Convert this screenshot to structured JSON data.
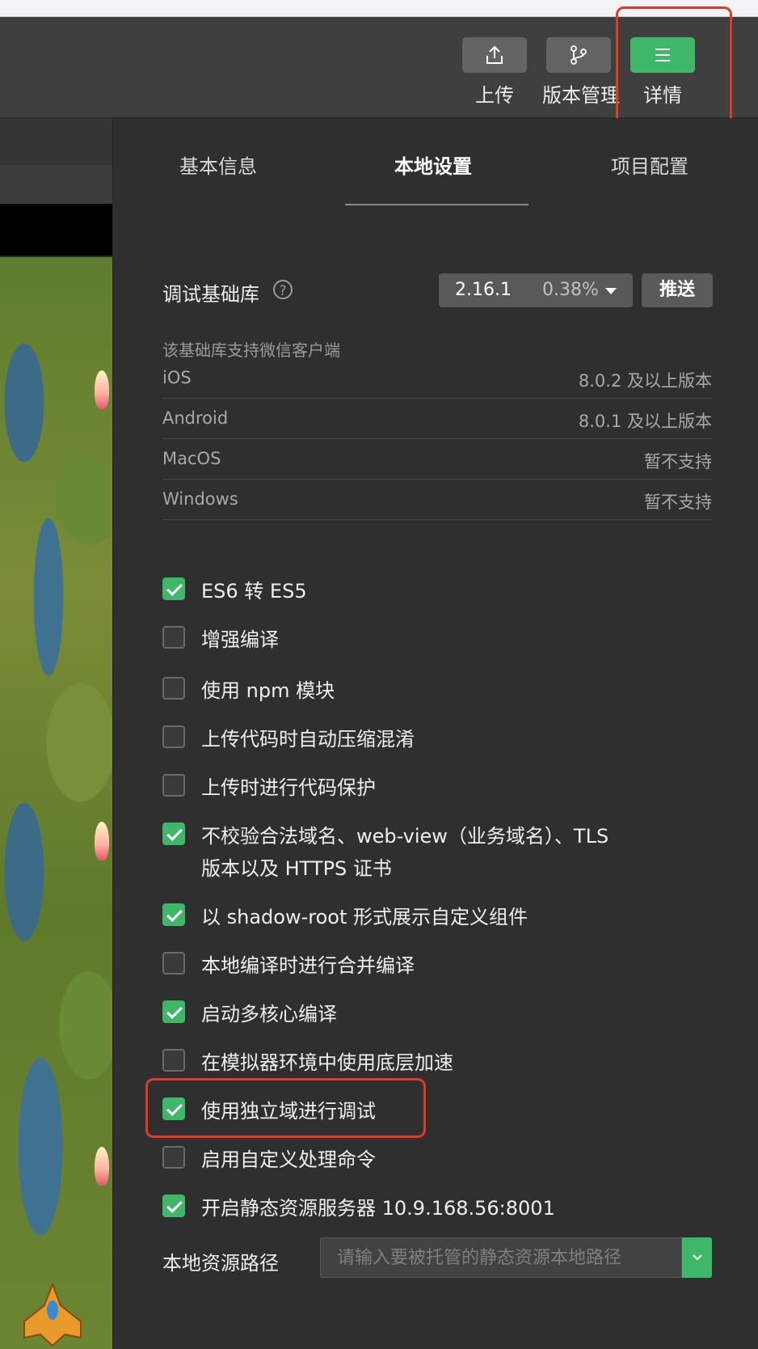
{
  "toolbar": {
    "upload_label": "上传",
    "version_label": "版本管理",
    "details_label": "详情"
  },
  "tabs": [
    {
      "label": "基本信息"
    },
    {
      "label": "本地设置"
    },
    {
      "label": "项目配置"
    }
  ],
  "active_tab": "本地设置",
  "lib": {
    "label": "调试基础库",
    "help": "?",
    "version": "2.16.1",
    "percent": "0.38%",
    "push_label": "推送"
  },
  "support": {
    "title": "该基础库支持微信客户端",
    "rows": [
      {
        "platform": "iOS",
        "value": "8.0.2 及以上版本"
      },
      {
        "platform": "Android",
        "value": "8.0.1 及以上版本"
      },
      {
        "platform": "MacOS",
        "value": "暂不支持"
      },
      {
        "platform": "Windows",
        "value": "暂不支持"
      }
    ]
  },
  "options": [
    {
      "label": "ES6 转 ES5",
      "checked": true
    },
    {
      "label": "增强编译",
      "checked": false
    },
    {
      "label": "使用 npm 模块",
      "checked": false
    },
    {
      "label": "上传代码时自动压缩混淆",
      "checked": false
    },
    {
      "label": "上传时进行代码保护",
      "checked": false
    },
    {
      "label": "不校验合法域名、web-view（业务域名）、TLS",
      "label2": "版本以及 HTTPS 证书",
      "checked": true
    },
    {
      "label": "以 shadow-root 形式展示自定义组件",
      "checked": true
    },
    {
      "label": "本地编译时进行合并编译",
      "checked": false
    },
    {
      "label": "启动多核心编译",
      "checked": true
    },
    {
      "label": "在模拟器环境中使用底层加速",
      "checked": false
    },
    {
      "label": "使用独立域进行调试",
      "checked": true
    },
    {
      "label": "启用自定义处理命令",
      "checked": false
    },
    {
      "label": "开启静态资源服务器 10.9.168.56:8001",
      "checked": true
    }
  ],
  "resource_path": {
    "label": "本地资源路径",
    "placeholder": "请输入要被托管的静态资源本地路径",
    "value": ""
  },
  "colors": {
    "accent_green": "#3fb768",
    "highlight_red": "#e23a2a",
    "panel_bg": "#2f2f2f"
  },
  "icons": {
    "upload": "upload-icon",
    "version": "branch-icon",
    "details": "menu-icon"
  }
}
